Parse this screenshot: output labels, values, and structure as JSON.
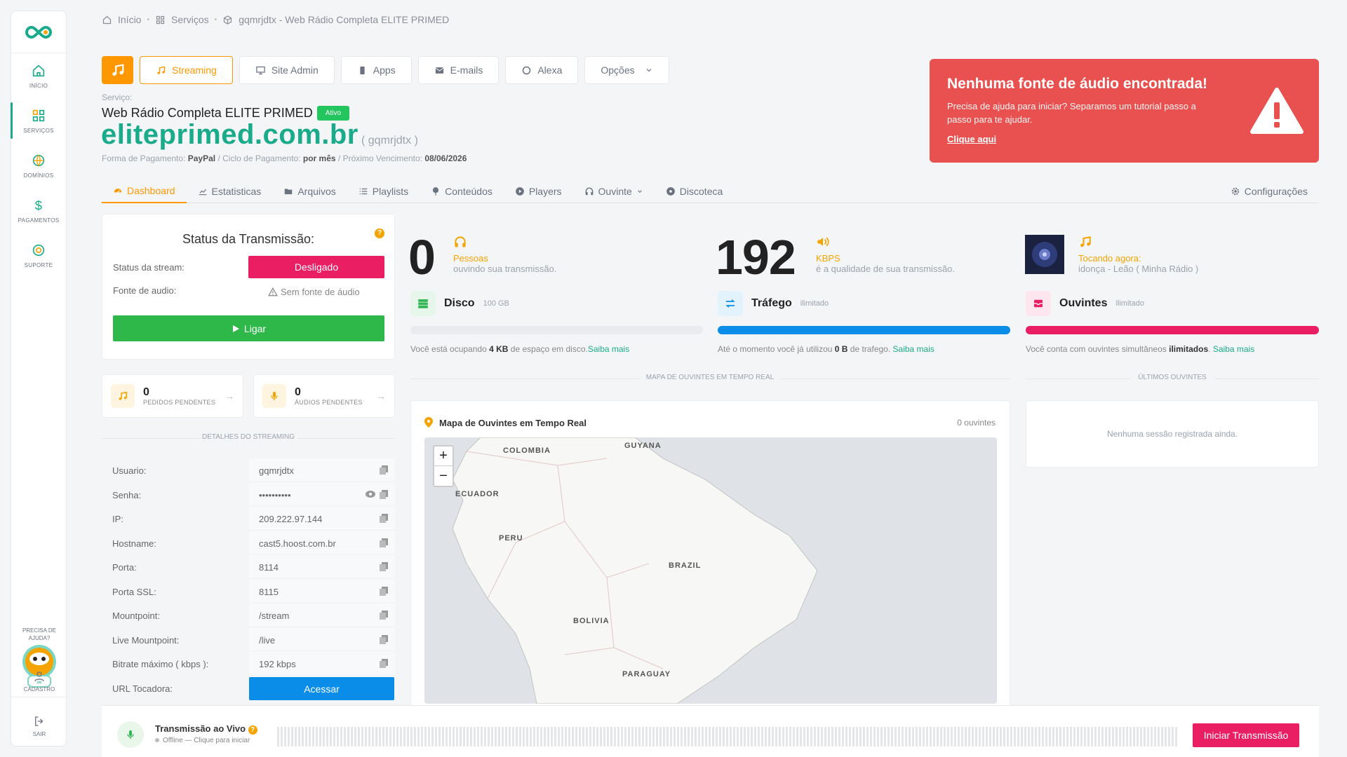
{
  "nav": {
    "items": [
      {
        "label": "INÍCIO",
        "icon": "home-icon"
      },
      {
        "label": "SERVIÇOS",
        "icon": "grid-icon"
      },
      {
        "label": "DOMÍNIOS",
        "icon": "globe-icon"
      },
      {
        "label": "PAGAMENTOS",
        "icon": "dollar-icon"
      },
      {
        "label": "SUPORTE",
        "icon": "support-icon"
      }
    ],
    "help_line1": "PRECISA DE",
    "help_line2": "AJUDA?",
    "cadastro": "CADASTRO",
    "sair": "SAIR"
  },
  "breadcrumb": {
    "home": "Início",
    "services": "Serviços",
    "current": "gqmrjdtx - Web Rádio Completa ELITE PRIMED"
  },
  "toolbar": {
    "streaming": "Streaming",
    "site_admin": "Site Admin",
    "apps": "Apps",
    "emails": "E-mails",
    "alexa": "Alexa",
    "opcoes": "Opções"
  },
  "service": {
    "label": "Serviço:",
    "name": "Web Rádio Completa ELITE PRIMED",
    "status": "Ativo",
    "domain": "eliteprimed.com.br",
    "id": "( gqmrjdtx )",
    "pay_label": "Forma de Pagamento:",
    "pay_value": "PayPal",
    "cycle_label": "/ Ciclo de Pagamento:",
    "cycle_value": "por mês",
    "due_label": "/ Próximo Vencimento:",
    "due_value": "08/06/2026"
  },
  "alert": {
    "title": "Nenhuma fonte de áudio encontrada!",
    "text": "Precisa de ajuda para iniciar? Separamos um tutorial passo a passo para te ajudar.",
    "link": "Clique aqui"
  },
  "tabs": [
    "Dashboard",
    "Estatisticas",
    "Arquivos",
    "Playlists",
    "Conteúdos",
    "Players",
    "Ouvinte",
    "Discoteca",
    "Configurações"
  ],
  "status": {
    "title": "Status da Transmissão:",
    "stream_label": "Status da stream:",
    "stream_value": "Desligado",
    "source_label": "Fonte de audio:",
    "source_value": "Sem fonte de áudio",
    "button": "Ligar"
  },
  "pending": {
    "pedidos": {
      "count": "0",
      "label": "PEDIDOS PENDENTES"
    },
    "audios": {
      "count": "0",
      "label": "ÁUDIOS PENDENTES"
    }
  },
  "details": {
    "title": "DETALHES DO STREAMING",
    "rows": [
      {
        "k": "Usuario:",
        "v": "gqmrjdtx"
      },
      {
        "k": "Senha:",
        "v": "••••••••••"
      },
      {
        "k": "IP:",
        "v": "209.222.97.144"
      },
      {
        "k": "Hostname:",
        "v": "cast5.hoost.com.br"
      },
      {
        "k": "Porta:",
        "v": "8114"
      },
      {
        "k": "Porta SSL:",
        "v": "8115"
      },
      {
        "k": "Mountpoint:",
        "v": "/stream"
      },
      {
        "k": "Live Mountpoint:",
        "v": "/live"
      },
      {
        "k": "Bitrate máximo ( kbps ):",
        "v": "192 kbps"
      },
      {
        "k": "URL Tocadora:",
        "v": "Acessar"
      }
    ]
  },
  "stats": {
    "listeners": {
      "value": "0",
      "label": "Pessoas",
      "desc": "ouvindo sua transmissão."
    },
    "bitrate": {
      "value": "192",
      "label": "KBPS",
      "desc": "é a qualidade de sua transmissão."
    },
    "now": {
      "label": "Tocando agora:",
      "track": "idonça - Leão ( Minha Rádio )"
    }
  },
  "metrics": {
    "disk": {
      "name": "Disco",
      "limit": "100 GB",
      "note_a": "Você está ocupando",
      "note_b": "4 KB",
      "note_c": "de espaço em disco.",
      "link": "Saiba mais",
      "fill": 0.0
    },
    "traffic": {
      "name": "Tráfego",
      "limit": "ilimitado",
      "note_a": "Até o momento você já utilizou",
      "note_b": "0 B",
      "note_c": "de trafego.",
      "link": "Saiba mais",
      "fill": 1.0
    },
    "listeners": {
      "name": "Ouvintes",
      "limit": "ilimitado",
      "note_a": "Você conta com ouvintes simultâneos",
      "note_b": "ilimitados",
      "note_c": ".",
      "link": "Saiba mais",
      "fill": 1.0
    },
    "colors": {
      "disk": "#e9ebee",
      "traffic": "#0a8de8",
      "listeners": "#e91e63"
    }
  },
  "map": {
    "divider": "MAPA DE OUVINTES EM TEMPO REAL",
    "title": "Mapa de Ouvintes em Tempo Real",
    "count": "0 ouvintes",
    "labels": [
      "COLOMBIA",
      "GUYANA",
      "ECUADOR",
      "PERU",
      "BRAZIL",
      "BOLIVIA",
      "PARAGUAY"
    ],
    "zoom_in": "+",
    "zoom_out": "−"
  },
  "last": {
    "divider": "ÚLTIMOS OUVINTES",
    "empty": "Nenhuma sessão registrada ainda."
  },
  "live": {
    "title": "Transmissão ao Vivo",
    "sub": "Offline — Clique para iniciar",
    "button": "Iniciar Transmissão"
  }
}
